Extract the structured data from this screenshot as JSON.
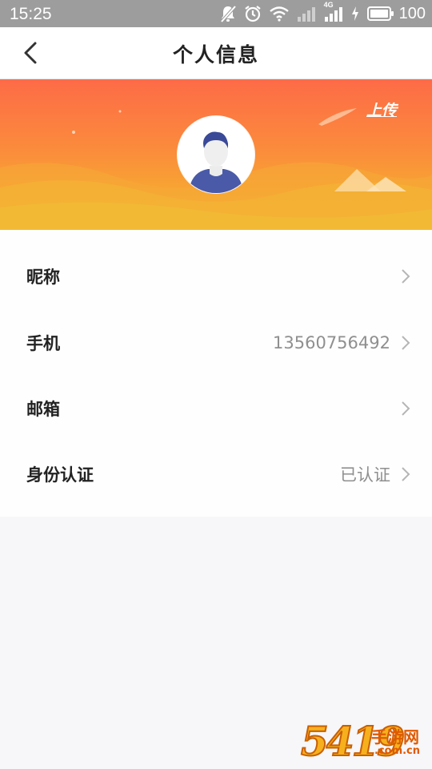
{
  "status_bar": {
    "time": "15:25",
    "network_label": "4G",
    "battery_level": "100",
    "icons": [
      "mute-icon",
      "alarm-icon",
      "wifi-icon",
      "signal-icon",
      "signal-4g-icon",
      "charging-icon",
      "battery-icon"
    ]
  },
  "nav": {
    "title": "个人信息",
    "back_icon": "chevron-left-icon"
  },
  "header": {
    "upload_label": "上传",
    "avatar_icon": "default-avatar-icon"
  },
  "list": {
    "items": [
      {
        "label": "昵称",
        "value": ""
      },
      {
        "label": "手机",
        "value": "13560756492"
      },
      {
        "label": "邮箱",
        "value": ""
      },
      {
        "label": "身份认证",
        "value": "已认证"
      }
    ]
  },
  "watermark": {
    "digits": "5419",
    "site": "手游网",
    "domain": ".com.cn"
  },
  "colors": {
    "banner_top": "#fd6b47",
    "banner_bottom": "#f2b631",
    "status_bar": "#9d9d9d",
    "label_text": "#222222",
    "value_text": "#8f8f8f"
  }
}
